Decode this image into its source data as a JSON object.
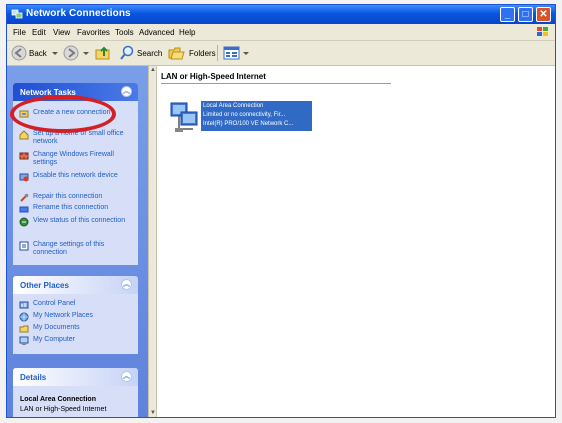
{
  "window": {
    "title": "Network Connections"
  },
  "menu": [
    "File",
    "Edit",
    "View",
    "Favorites",
    "Tools",
    "Advanced",
    "Help"
  ],
  "toolbar": {
    "back_label": "Back",
    "search_label": "Search",
    "folders_label": "Folders"
  },
  "network_tasks": {
    "title": "Network Tasks",
    "items": [
      {
        "icon": "new-connection-icon",
        "label": "Create a new connection"
      },
      {
        "icon": "home-network-icon",
        "label": "Set up a home or small office network"
      },
      {
        "icon": "firewall-icon",
        "label": "Change Windows Firewall settings"
      },
      {
        "icon": "disable-device-icon",
        "label": "Disable this network device"
      },
      {
        "icon": "repair-icon",
        "label": "Repair this connection"
      },
      {
        "icon": "rename-icon",
        "label": "Rename this connection"
      },
      {
        "icon": "status-icon",
        "label": "View status of this connection"
      },
      {
        "icon": "settings-icon",
        "label": "Change settings of this connection"
      }
    ]
  },
  "other_places": {
    "title": "Other Places",
    "items": [
      {
        "icon": "control-panel-icon",
        "label": "Control Panel"
      },
      {
        "icon": "network-places-icon",
        "label": "My Network Places"
      },
      {
        "icon": "documents-icon",
        "label": "My Documents"
      },
      {
        "icon": "computer-icon",
        "label": "My Computer"
      }
    ]
  },
  "details": {
    "title": "Details",
    "name": "Local Area Connection",
    "type": "LAN or High-Speed Internet"
  },
  "main": {
    "group_title": "LAN or High-Speed Internet",
    "connection": {
      "name": "Local Area Connection",
      "status": "Limited or no connectivity, Fir...",
      "device": "Intel(R) PRO/100 VE Network C..."
    }
  },
  "colors": {
    "highlight_ring": "#d41f26",
    "selection": "#316ac5",
    "link": "#215dc6"
  }
}
